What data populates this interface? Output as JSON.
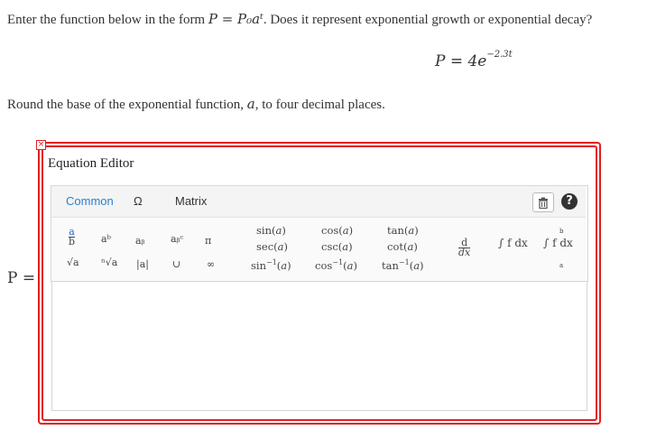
{
  "question": {
    "text_before": "Enter the function below in the form ",
    "form_expr": "P = P₀aᵗ",
    "text_after": ". Does it represent exponential growth or exponential decay?"
  },
  "given": {
    "lhs": "P = 4e",
    "exponent": "−2.3t"
  },
  "instruction": {
    "before": "Round the base of the exponential function, ",
    "var": "a",
    "after": ", to four decimal places."
  },
  "answer_label": "P =",
  "editor": {
    "close_icon": "×",
    "title": "Equation Editor",
    "tabs": [
      "Common",
      "Ω",
      "Matrix"
    ],
    "help_label": "?",
    "symbols": {
      "frac": {
        "num": "a",
        "den": "b"
      },
      "power": "aᵇ",
      "subscript": "aᵦ",
      "power_sub": "aᵦᶜ",
      "pi": "π",
      "sqrt": "√a",
      "nthroot": "ⁿ√a",
      "abs": "|a|",
      "union": "∪",
      "infinity": "∞"
    },
    "trig": {
      "sin": "sin",
      "cos": "cos",
      "tan": "tan",
      "sec": "sec",
      "csc": "csc",
      "cot": "cot",
      "asin": "sin",
      "acos": "cos",
      "atan": "tan",
      "inv": "−1",
      "arg": "a"
    },
    "calculus": {
      "d_num": "d",
      "d_den": "dx",
      "integral": "∫ f dx",
      "def_integral": "∫ f dx",
      "upper": "b",
      "lower": "a"
    }
  },
  "colors": {
    "frame": "#e02020",
    "active_tab": "#2a7fd0"
  }
}
